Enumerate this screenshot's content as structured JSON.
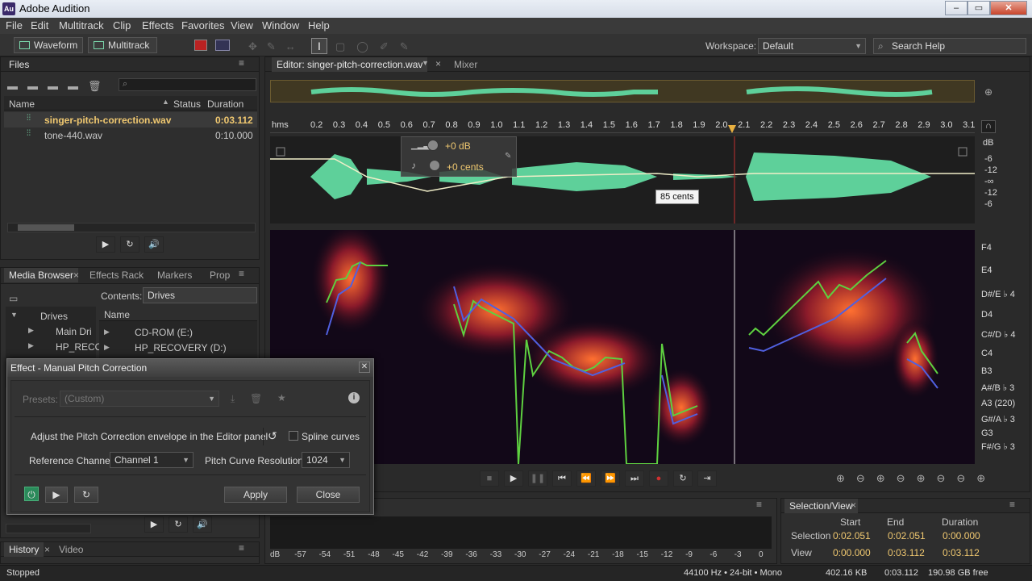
{
  "app": {
    "title": "Adobe Audition",
    "logo": "Au"
  },
  "menu": [
    "File",
    "Edit",
    "Multitrack",
    "Clip",
    "Effects",
    "Favorites",
    "View",
    "Window",
    "Help"
  ],
  "toolbar": {
    "waveform": "Waveform",
    "multitrack": "Multitrack",
    "workspace_label": "Workspace:",
    "workspace_value": "Default",
    "search_placeholder": "Search Help"
  },
  "files_panel": {
    "title": "Files",
    "columns": [
      "Name",
      "Status",
      "Duration"
    ],
    "rows": [
      {
        "name": "singer-pitch-correction.wav",
        "duration": "0:03.112"
      },
      {
        "name": "tone-440.wav",
        "duration": "0:10.000"
      }
    ]
  },
  "media_panel": {
    "tabs": [
      "Media Browser",
      "Effects Rack",
      "Markers",
      "Prop"
    ],
    "contents_label": "Contents:",
    "contents_value": "Drives",
    "tree": [
      "Drives",
      "Main Dri",
      "HP_RECO"
    ],
    "list_header": "Name",
    "list": [
      "CD-ROM (E:)",
      "HP_RECOVERY (D:)"
    ]
  },
  "history_panel": {
    "tabs": [
      "History",
      "Video"
    ]
  },
  "editor": {
    "tab": "Editor: singer-pitch-correction.wav",
    "mixer_tab": "Mixer",
    "ruler_unit": "hms",
    "ruler": [
      "0.2",
      "0.3",
      "0.4",
      "0.5",
      "0.6",
      "0.7",
      "0.8",
      "0.9",
      "1.0",
      "1.1",
      "1.2",
      "1.3",
      "1.4",
      "1.5",
      "1.6",
      "1.7",
      "1.8",
      "1.9",
      "2.0",
      "2.1",
      "2.2",
      "2.3",
      "2.4",
      "2.5",
      "2.6",
      "2.7",
      "2.8",
      "2.9",
      "3.0",
      "3.1"
    ],
    "hud_volume": "+0 dB",
    "hud_pitch": "+0 cents",
    "tooltip": "85 cents",
    "db_scale": [
      "dB",
      "-6",
      "-12",
      "-∞",
      "-12",
      "-6"
    ],
    "note_scale": [
      "F4",
      "E4",
      "D#/E ♭ 4",
      "D4",
      "C#/D ♭ 4",
      "C4",
      "B3",
      "A#/B ♭ 3",
      "A3 (220)",
      "G#/A ♭ 3",
      "G3",
      "F#/G ♭ 3"
    ]
  },
  "dialog": {
    "title": "Effect - Manual Pitch Correction",
    "presets_label": "Presets:",
    "presets_value": "(Custom)",
    "instruction": "Adjust the Pitch Correction envelope in the Editor panel",
    "spline_label": "Spline curves",
    "ref_channel_label": "Reference Channel:",
    "ref_channel_value": "Channel 1",
    "resolution_label": "Pitch Curve Resolution:",
    "resolution_value": "1024",
    "apply": "Apply",
    "close": "Close"
  },
  "level_meter": {
    "scale": [
      "dB",
      "-57",
      "-54",
      "-51",
      "-48",
      "-45",
      "-42",
      "-39",
      "-36",
      "-33",
      "-30",
      "-27",
      "-24",
      "-21",
      "-18",
      "-15",
      "-12",
      "-9",
      "-6",
      "-3",
      "0"
    ]
  },
  "selection_view": {
    "title": "Selection/View",
    "headers": [
      "Start",
      "End",
      "Duration"
    ],
    "rows": [
      {
        "label": "Selection",
        "start": "0:02.051",
        "end": "0:02.051",
        "duration": "0:00.000"
      },
      {
        "label": "View",
        "start": "0:00.000",
        "end": "0:03.112",
        "duration": "0:03.112"
      }
    ]
  },
  "status": {
    "state": "Stopped",
    "format": "44100 Hz • 24-bit • Mono",
    "size": "402.16 KB",
    "duration": "0:03.112",
    "free": "190.98 GB free"
  }
}
